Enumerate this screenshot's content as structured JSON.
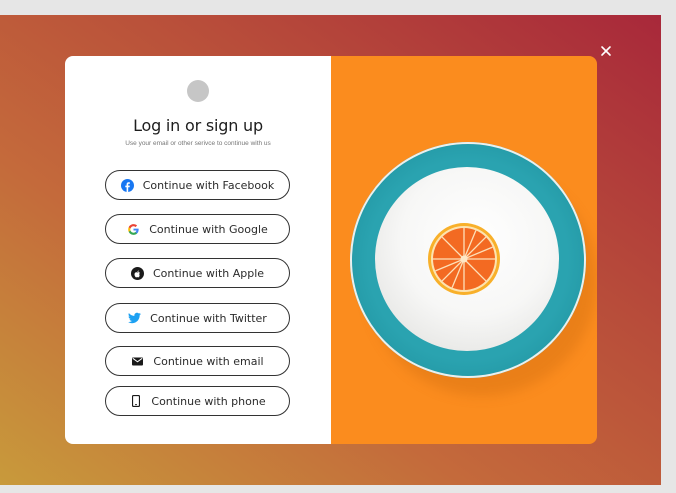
{
  "modal": {
    "title": "Log in or sign up",
    "subtitle": "Use your email or other serivce to continue with us"
  },
  "buttons": [
    {
      "label": "Continue with Facebook",
      "icon": "facebook-icon"
    },
    {
      "label": "Continue with Google",
      "icon": "google-icon"
    },
    {
      "label": "Continue with Apple",
      "icon": "apple-icon"
    },
    {
      "label": "Continue with Twitter",
      "icon": "twitter-icon"
    },
    {
      "label": "Continue with email",
      "icon": "email-icon"
    },
    {
      "label": "Continue with phone",
      "icon": "phone-icon"
    }
  ],
  "colors": {
    "facebook": "#1877f2",
    "twitter": "#1da1f2",
    "accent_orange": "#fb8c1e",
    "plate_teal": "#2aa7b4"
  },
  "close": {
    "icon": "close-icon"
  }
}
